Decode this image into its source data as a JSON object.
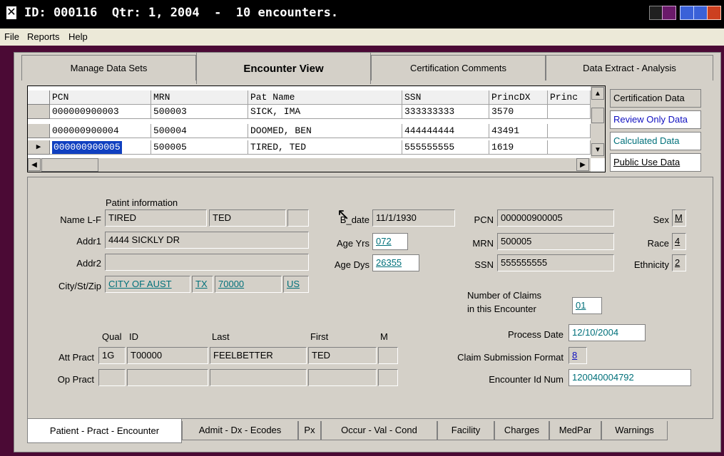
{
  "window": {
    "title": "ID: 000116  Qtr: 1, 2004  -  10 encounters.",
    "app_icon": "x-icon"
  },
  "menu": [
    "File",
    "Reports",
    "Help"
  ],
  "top_tabs": [
    "Manage Data Sets",
    "Encounter View",
    "Certification Comments",
    "Data Extract - Analysis"
  ],
  "grid": {
    "columns": [
      "PCN",
      "MRN",
      "Pat Name",
      "SSN",
      "PrincDX",
      "Princ"
    ],
    "rows": [
      [
        "000000900003",
        "500003",
        "SICK, IMA",
        "333333333",
        "3570",
        ""
      ],
      [
        "000000900004",
        "500004",
        "DOOMED, BEN",
        "444444444",
        "43491",
        ""
      ],
      [
        "000000900005",
        "500005",
        "TIRED, TED",
        "555555555",
        "1619",
        ""
      ]
    ]
  },
  "legend": {
    "certification": "Certification Data",
    "review_only": "Review Only Data",
    "calculated": "Calculated Data",
    "public_use": "Public Use Data"
  },
  "patient": {
    "section_label": "Patint information",
    "name_label": "Name L-F",
    "last": "TIRED",
    "first": "TED",
    "middle": "",
    "addr1_label": "Addr1",
    "addr1": "4444 SICKLY DR",
    "addr2_label": "Addr2",
    "addr2": "",
    "city_label": "City/St/Zip",
    "city": "CITY OF AUST",
    "state": "TX",
    "zip": "70000",
    "country": "US",
    "bdate_label": "B_date",
    "bdate": "11/1/1930",
    "age_yrs_label": "Age Yrs",
    "age_yrs": "072",
    "age_dys_label": "Age Dys",
    "age_dys": "26355",
    "pcn_label": "PCN",
    "pcn": "000000900005",
    "mrn_label": "MRN",
    "mrn": "500005",
    "ssn_label": "SSN",
    "ssn": "555555555",
    "sex_label": "Sex",
    "sex": "M",
    "race_label": "Race",
    "race": "4",
    "ethnicity_label": "Ethnicity",
    "ethnicity": "2"
  },
  "encounter": {
    "claims_label_1": "Number of Claims",
    "claims_label_2": "in this Encounter",
    "claims": "01",
    "process_date_label": "Process Date",
    "process_date": "12/10/2004",
    "claim_format_label": "Claim Submission Format",
    "claim_format": "8",
    "encounter_id_label": "Encounter Id Num",
    "encounter_id": "120040004792"
  },
  "practitioners": {
    "col_qual": "Qual",
    "col_id": "ID",
    "col_last": "Last",
    "col_first": "First",
    "col_m": "M",
    "att_label": "Att Pract",
    "att_qual": "1G",
    "att_id": "T00000",
    "att_last": "FEELBETTER",
    "att_first": "TED",
    "att_m": "",
    "op_label": "Op Pract"
  },
  "bottom_tabs": [
    "Patient - Pract - Encounter",
    "Admit - Dx - Ecodes",
    "Px",
    "Occur - Val - Cond",
    "Facility",
    "Charges",
    "MedPar",
    "Warnings"
  ]
}
